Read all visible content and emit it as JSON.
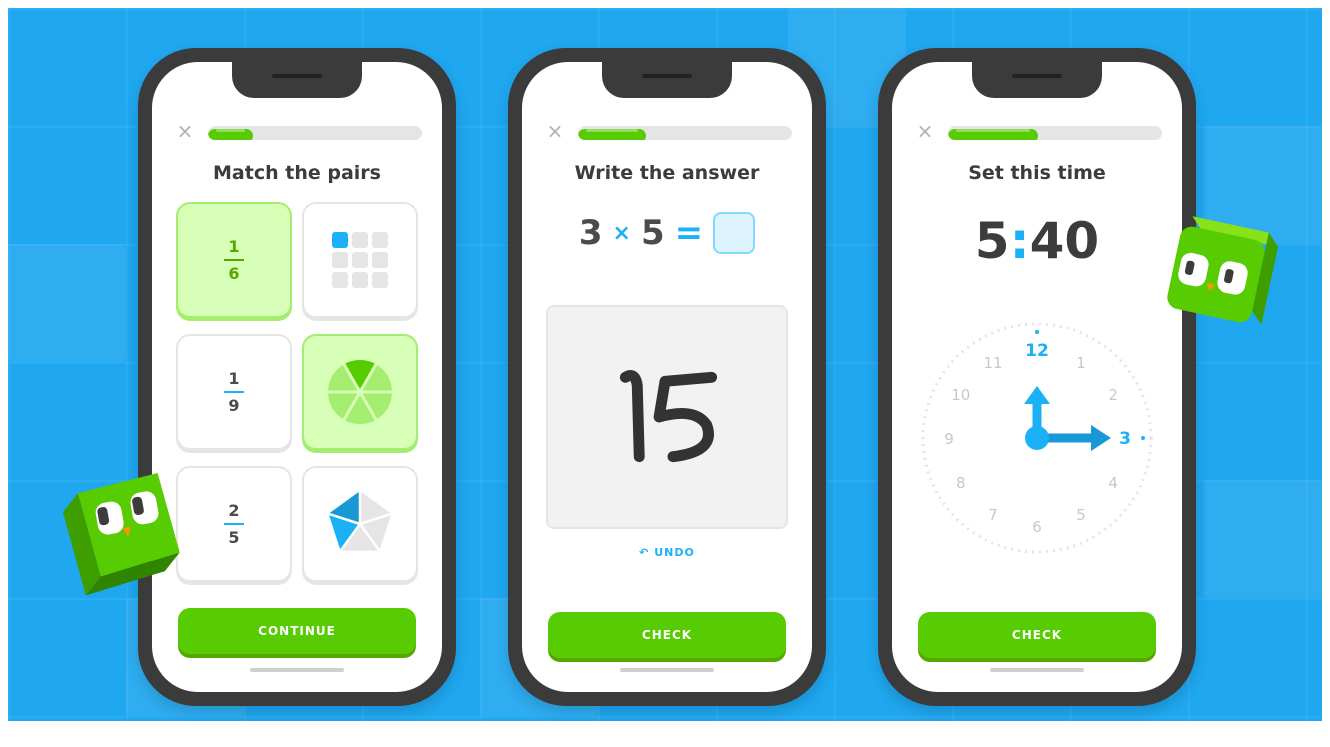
{
  "phones": [
    {
      "title": "Match the pairs",
      "close_label": "×",
      "progress": 0.21,
      "pairs": [
        {
          "numerator": "1",
          "denominator": "6",
          "selected": true
        },
        {
          "picture": "grid-1-of-9-icon",
          "selected": false
        },
        {
          "numerator": "1",
          "denominator": "9",
          "selected": false
        },
        {
          "picture": "circle-1-of-6-icon",
          "selected": true
        },
        {
          "numerator": "2",
          "denominator": "5",
          "selected": false
        },
        {
          "picture": "pentagon-2-of-5-icon",
          "selected": false
        }
      ],
      "button_label": "CONTINUE"
    },
    {
      "title": "Write the answer",
      "close_label": "×",
      "progress": 0.32,
      "equation": {
        "a": "3",
        "op": "×",
        "b": "5",
        "eq": "="
      },
      "handwriting": "15",
      "undo_label": "UNDO",
      "button_label": "CHECK"
    },
    {
      "title": "Set this time",
      "close_label": "×",
      "progress": 0.42,
      "time": {
        "hours": "5",
        "colon": ":",
        "minutes": "40"
      },
      "clock_numbers": [
        "12",
        "1",
        "2",
        "3",
        "4",
        "5",
        "6",
        "7",
        "8",
        "9",
        "10",
        "11"
      ],
      "button_label": "CHECK"
    }
  ],
  "colors": {
    "background": "#1fa7f0",
    "brand_green": "#58cc02",
    "accent_blue": "#1cb0f6",
    "selected_green_bg": "#d7ffb8"
  }
}
